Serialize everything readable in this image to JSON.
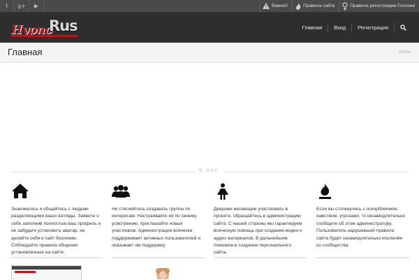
{
  "topbar": {
    "social": [
      {
        "icon": "twitter-icon",
        "glyph": "t"
      },
      {
        "icon": "google-plus-icon",
        "glyph": "g+"
      },
      {
        "icon": "youtube-icon",
        "glyph": "▶"
      }
    ],
    "links": [
      {
        "icon": "warning-icon",
        "label": "Важно!!"
      },
      {
        "icon": "fire-icon",
        "label": "Правила сайта"
      },
      {
        "icon": "female-symbol-icon",
        "label": "Правила регистрации Госпожи"
      }
    ]
  },
  "header": {
    "logo": {
      "part1": "Hypno",
      "part2": "Rus"
    },
    "nav": [
      {
        "label": "Главная"
      },
      {
        "label": "Вход"
      },
      {
        "label": "Регистрация"
      }
    ],
    "search_icon": "search-icon"
  },
  "page": {
    "title": "Главная",
    "breadcrumb": "Home"
  },
  "about": {
    "divider_label": "О НАС",
    "features": [
      {
        "icon": "home-icon",
        "text": "Знакомьтесь и общайтесь с людьми разделяющими ваши взгляды. Заявите о себе заполнив полностью ваш профиль и не забудьте установить аватар, не делайте себя и сайт безликим. Соблюдайте правила общения установленные на сайте."
      },
      {
        "icon": "group-icon",
        "text": "Не стесняйтесь создавать группы по интересам. Настраивайте её по своему усмотрению, приглашайте новых участников. Администрация всячески поддерживает активных пользователей и оказывает им поддержку."
      },
      {
        "icon": "female-icon",
        "text": "Девушки желающие участвовать в проекте, обращайтесь в администрацию сайта. С нашей стороны мы гарантируем всяческую помощь при создании видео и аудио материалов. В дальнейшем поможем в создании персонального сайта."
      },
      {
        "icon": "fire-icon",
        "text": "Если вы столкнулись с оскорблением, хамством, угрозами, то незамедлительно сообщите об этом администратору. Пользователь нарушевший правила сайта будет незамедлительно исключён из сообщества."
      }
    ]
  },
  "colors": {
    "accent": "#b0181c",
    "header_bg": "#2e2e2e",
    "topbar_bg": "#4a4a4a"
  }
}
